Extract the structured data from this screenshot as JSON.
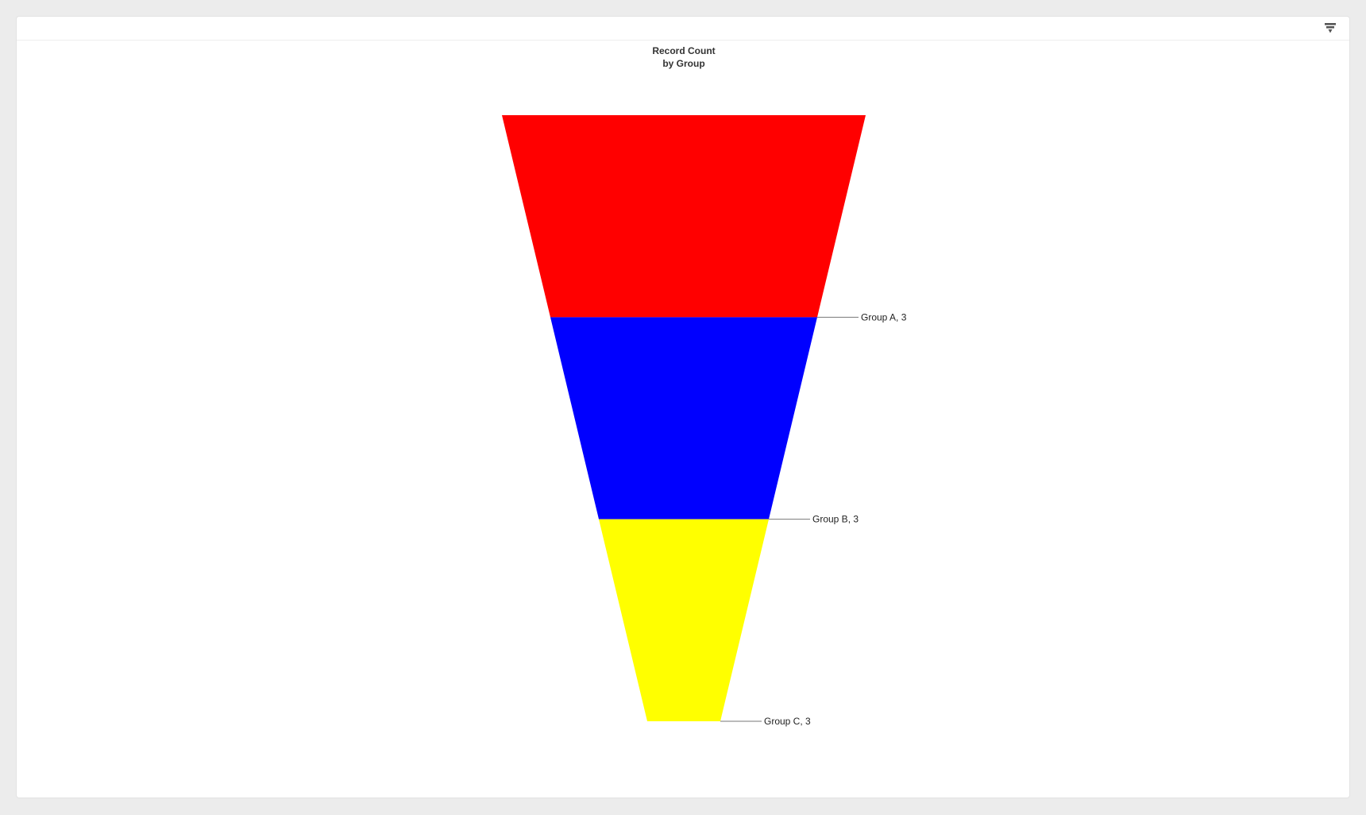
{
  "chart_data": {
    "type": "funnel",
    "title": "Record Count",
    "subtitle": "by Group",
    "categories": [
      "Group A",
      "Group B",
      "Group C"
    ],
    "values": [
      3,
      3,
      3
    ],
    "labels": [
      "Group A, 3",
      "Group B, 3",
      "Group C, 3"
    ],
    "colors": [
      "#ff0000",
      "#0000ff",
      "#ffff00"
    ],
    "legend": "none",
    "grid": false
  },
  "toolbar": {
    "filter_icon": "filter-icon"
  }
}
